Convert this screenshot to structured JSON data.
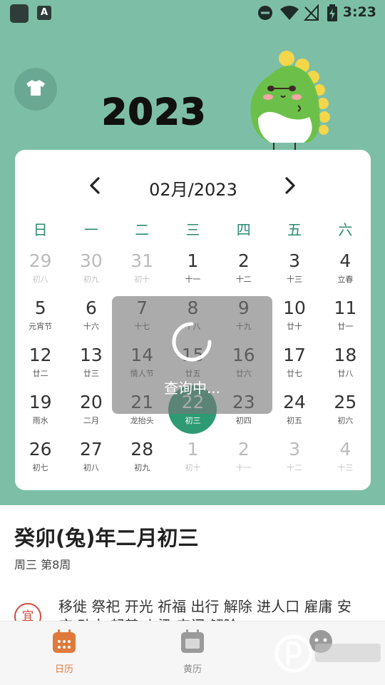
{
  "status_bar": {
    "time": "3:23",
    "app_badge": "A"
  },
  "header": {
    "year_label": "2023"
  },
  "calendar": {
    "month_title": "02月/2023",
    "weekdays": [
      "日",
      "一",
      "二",
      "三",
      "四",
      "五",
      "六"
    ],
    "weeks": [
      [
        {
          "d": "29",
          "l": "初八",
          "o": true
        },
        {
          "d": "30",
          "l": "初九",
          "o": true
        },
        {
          "d": "31",
          "l": "初十",
          "o": true
        },
        {
          "d": "1",
          "l": "十一"
        },
        {
          "d": "2",
          "l": "十二"
        },
        {
          "d": "3",
          "l": "十三"
        },
        {
          "d": "4",
          "l": "立春"
        }
      ],
      [
        {
          "d": "5",
          "l": "元宵节"
        },
        {
          "d": "6",
          "l": "十六"
        },
        {
          "d": "7",
          "l": "十七"
        },
        {
          "d": "8",
          "l": "十八"
        },
        {
          "d": "9",
          "l": "十九"
        },
        {
          "d": "10",
          "l": "廿十"
        },
        {
          "d": "11",
          "l": "廿一"
        }
      ],
      [
        {
          "d": "12",
          "l": "廿二"
        },
        {
          "d": "13",
          "l": "廿三"
        },
        {
          "d": "14",
          "l": "情人节"
        },
        {
          "d": "15",
          "l": "廿五"
        },
        {
          "d": "16",
          "l": "廿六"
        },
        {
          "d": "17",
          "l": "廿七"
        },
        {
          "d": "18",
          "l": "廿八"
        }
      ],
      [
        {
          "d": "19",
          "l": "雨水"
        },
        {
          "d": "20",
          "l": "二月"
        },
        {
          "d": "21",
          "l": "龙抬头"
        },
        {
          "d": "22",
          "l": "初三",
          "s": true
        },
        {
          "d": "23",
          "l": "初四"
        },
        {
          "d": "24",
          "l": "初五"
        },
        {
          "d": "25",
          "l": "初六"
        }
      ],
      [
        {
          "d": "26",
          "l": "初七"
        },
        {
          "d": "27",
          "l": "初八"
        },
        {
          "d": "28",
          "l": "初九"
        },
        {
          "d": "1",
          "l": "初十",
          "o": true
        },
        {
          "d": "2",
          "l": "十一",
          "o": true
        },
        {
          "d": "3",
          "l": "十二",
          "o": true
        },
        {
          "d": "4",
          "l": "十三",
          "o": true
        }
      ]
    ],
    "loading_text": "查询中..."
  },
  "detail": {
    "lunar_date": "癸卯(兔)年二月初三",
    "week_info": "周三 第8周",
    "yi_label": "宜",
    "yi_items": "移徙 祭祀 开光 祈福 出行 解除 进人口 雇庸 安床 动土 起基 上梁 安门 解除"
  },
  "tabbar": {
    "tabs": [
      {
        "label": "日历"
      },
      {
        "label": "黄历"
      }
    ]
  },
  "colors": {
    "header_bg": "#7dbfa6",
    "accent_green": "#2e9a74",
    "weekday_green": "#2b8a72",
    "yi_red": "#d24b3e",
    "tab_active": "#e07a3c"
  }
}
